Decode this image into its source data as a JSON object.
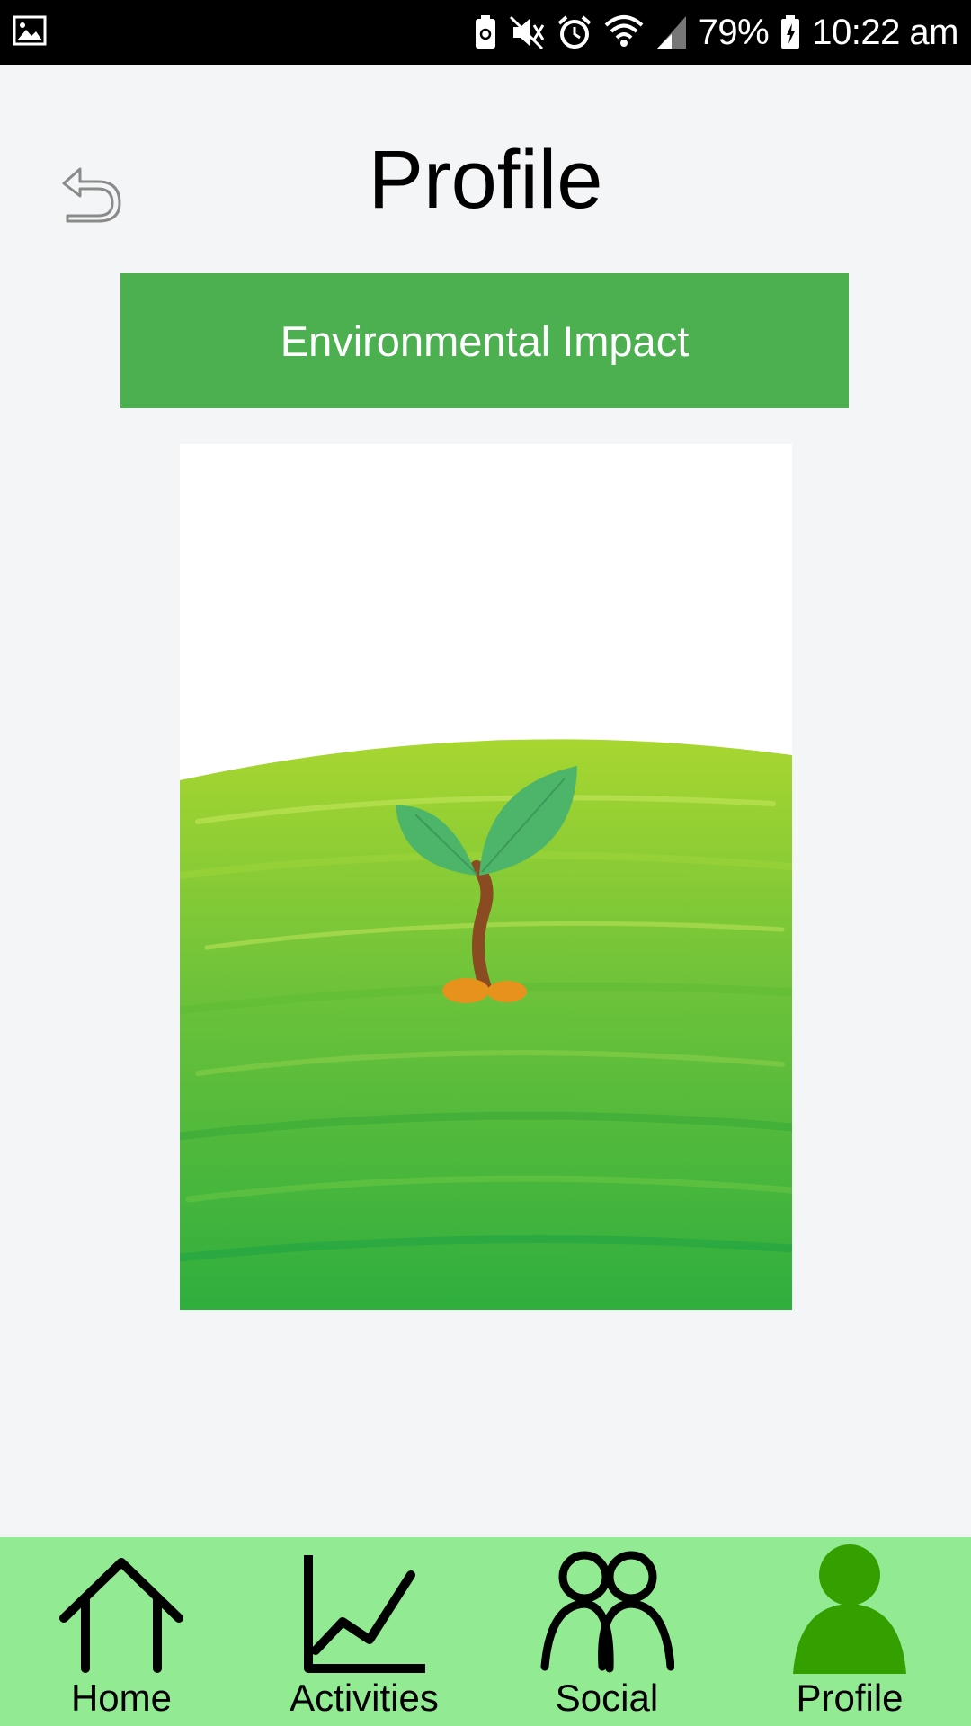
{
  "status_bar": {
    "battery_percent": "79%",
    "time": "10:22 am",
    "icons": [
      "gallery-icon",
      "battery-saver-icon",
      "vibrate-mute-icon",
      "alarm-icon",
      "wifi-icon",
      "signal-icon",
      "battery-icon"
    ]
  },
  "header": {
    "title": "Profile",
    "back_icon": "undo-arrow-icon"
  },
  "impact_button": {
    "label": "Environmental Impact",
    "color": "#4caf50"
  },
  "illustration": {
    "subject": "sprout-on-grass-hill"
  },
  "bottom_nav": {
    "background": "#92eb92",
    "active_color": "#34a000",
    "items": [
      {
        "label": "Home",
        "icon": "home-icon",
        "active": false
      },
      {
        "label": "Activities",
        "icon": "chart-icon",
        "active": false
      },
      {
        "label": "Social",
        "icon": "people-icon",
        "active": false
      },
      {
        "label": "Profile",
        "icon": "person-icon",
        "active": true
      }
    ]
  }
}
